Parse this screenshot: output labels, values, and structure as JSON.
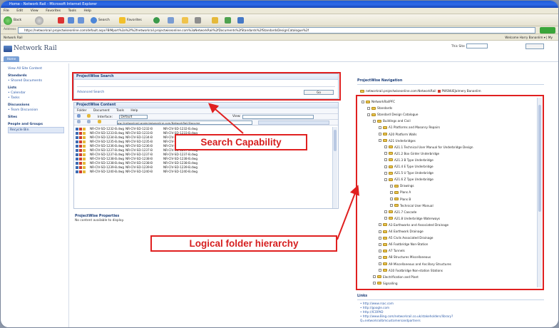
{
  "browser": {
    "title": "Home - Network Rail - Microsoft Internet Explorer",
    "menu": [
      "File",
      "Edit",
      "View",
      "Favorites",
      "Tools",
      "Help"
    ],
    "back_label": "Back",
    "search_label": "Search",
    "favorites_label": "Favorites",
    "address_label": "Address",
    "address_value": "https://networkrail.projectwiseonline.com/default.aspx?BIMport%3a%2f%2fnetworkrail.projectwiseonline.com%3aNetworkRail%2fDocuments%2fStandards%2fStandardsDesignCatalogue%2f",
    "favbar_left": "Network Rail",
    "favbar_right": "Welcome Harry Bananlim  ▾  |  My"
  },
  "app": {
    "title": "Network Rail",
    "tab": "Home",
    "view_label": "This Site"
  },
  "leftnav": {
    "items": [
      {
        "text": "View All Site Content",
        "kind": "link"
      },
      {
        "text": "Standards",
        "kind": "head"
      },
      {
        "text": "• Shared Documents",
        "kind": "link"
      },
      {
        "text": "Lists",
        "kind": "head"
      },
      {
        "text": "• Calendar",
        "kind": "link"
      },
      {
        "text": "• Tasks",
        "kind": "link"
      },
      {
        "text": "Discussions",
        "kind": "head"
      },
      {
        "text": "• Team Discussion",
        "kind": "link"
      },
      {
        "text": "Sites",
        "kind": "head"
      },
      {
        "text": "People and Groups",
        "kind": "head"
      },
      {
        "text": "Recycle Bin",
        "kind": "selected"
      }
    ]
  },
  "search_panel": {
    "title": "ProjectWise Search",
    "advanced": "Advanced Search",
    "go": "Go"
  },
  "content_panel": {
    "title": "ProjectWise Content",
    "menu": [
      "Folder",
      "Document",
      "Tools",
      "Help"
    ],
    "interface_label": "Interface:",
    "interface_value": "Default",
    "view_label": "View:",
    "path": "pw://networkrail.projectwiseonline.com/NetworkRail/Docume",
    "rows": [
      [
        "NR-CIV-SD-1232-B.dwg",
        "NR-CIV-SD-1232-B",
        "NR-CIV-SD-1232-B.dwg"
      ],
      [
        "NR-CIV-SD-1233-B.dwg",
        "NR-CIV-SD-1233-B",
        "NR-CIV-SD-1233-B.dwg"
      ],
      [
        "NR-CIV-SD-1234-B.dwg",
        "NR-CIV-SD-1234-B",
        "NR-CIV-SD-1234-B.dwg"
      ],
      [
        "NR-CIV-SD-1235-B.dwg",
        "NR-CIV-SD-1235-B",
        "NR-CIV-SD-1235-B.dwg"
      ],
      [
        "NR-CIV-SD-1236-B.dwg",
        "NR-CIV-SD-1236-B",
        "NR-CIV-SD-1236-B.dwg"
      ],
      [
        "NR-CIV-SD-1237-B.dwg",
        "NR-CIV-SD-1237-B",
        "NR-CIV-SD-1237-B.dwg"
      ],
      [
        "NR-CIV-SD-1237-B.dwg",
        "NR-CIV-SD-1237-B",
        "NR-CIV-SD-1237-B.dwg"
      ],
      [
        "NR-CIV-SD-1238-B.dwg",
        "NR-CIV-SD-1238-B",
        "NR-CIV-SD-1238-B.dwg"
      ],
      [
        "NR-CIV-SD-1238-B.dwg",
        "NR-CIV-SD-1238-B",
        "NR-CIV-SD-1238-B.dwg"
      ],
      [
        "NR-CIV-SD-1239-B.dwg",
        "NR-CIV-SD-1239-B",
        "NR-CIV-SD-1239-B.dwg"
      ],
      [
        "NR-CIV-SD-1240-B.dwg",
        "NR-CIV-SD-1240-B",
        "NR-CIV-SD-1240-B.dwg"
      ]
    ]
  },
  "properties_panel": {
    "title": "ProjectWise Properties",
    "empty": "No content available to display."
  },
  "nav_panel": {
    "title": "ProjectWise Navigation",
    "server": "networkrail.projectwiseonline.com:NetworkRail",
    "user": "PWSNUEJalmery Bananlim",
    "tree": [
      {
        "d": 0,
        "t": "NetworkRailPFC"
      },
      {
        "d": 1,
        "t": "Standards"
      },
      {
        "d": 1,
        "t": "Standard Design Catalogue"
      },
      {
        "d": 2,
        "t": "Buildings and Civil"
      },
      {
        "d": 3,
        "t": "A1 Platforms and Masonry Repairs"
      },
      {
        "d": 3,
        "t": "A20 Platform Walls"
      },
      {
        "d": 3,
        "t": "A21 Underbridges"
      },
      {
        "d": 4,
        "t": "A21.1 Technical User Manual for Underbridge Design"
      },
      {
        "d": 4,
        "t": "A21.2 Box Girder Underbridge"
      },
      {
        "d": 4,
        "t": "A21.3 B Type Underbridge"
      },
      {
        "d": 4,
        "t": "A21.4 E Type Underbridge"
      },
      {
        "d": 4,
        "t": "A21.5 U Type Underbridge"
      },
      {
        "d": 4,
        "t": "A21.6 Z Type Underbridge"
      },
      {
        "d": 5,
        "t": "Drawings"
      },
      {
        "d": 5,
        "t": "Plans A"
      },
      {
        "d": 5,
        "t": "Plans B"
      },
      {
        "d": 5,
        "t": "Technical User Manual"
      },
      {
        "d": 4,
        "t": "A21.7 Cascade"
      },
      {
        "d": 4,
        "t": "A21.8 Underbridge Waterways"
      },
      {
        "d": 3,
        "t": "A3 Earthworks and Associated Drainage"
      },
      {
        "d": 3,
        "t": "A4 Earthwork Drainage"
      },
      {
        "d": 3,
        "t": "A5 Civils Associated Drainage"
      },
      {
        "d": 3,
        "t": "A6 Footbridge Non-Station"
      },
      {
        "d": 3,
        "t": "A7 Tunnels"
      },
      {
        "d": 3,
        "t": "A8 Structures Miscellaneous"
      },
      {
        "d": 3,
        "t": "A9 Miscellaneous and Ancillary Structures"
      },
      {
        "d": 3,
        "t": "A10 Footbridge Non-station Stations"
      },
      {
        "d": 2,
        "t": "Electrification and Plant"
      },
      {
        "d": 2,
        "t": "Signalling"
      }
    ]
  },
  "links_panel": {
    "title": "Links",
    "items": [
      "• http://www.rsac.com",
      "• http://google.com",
      "• http://ICOPAD",
      "• http://www.Bing.com/networkrail.co.uk/stakeholders/library?",
      "  Q=networkrailbmcustomersandpartners"
    ]
  },
  "annotations": {
    "search": "Search Capability",
    "hierarchy": "Logical folder hierarchy",
    "color": "#e02020"
  }
}
